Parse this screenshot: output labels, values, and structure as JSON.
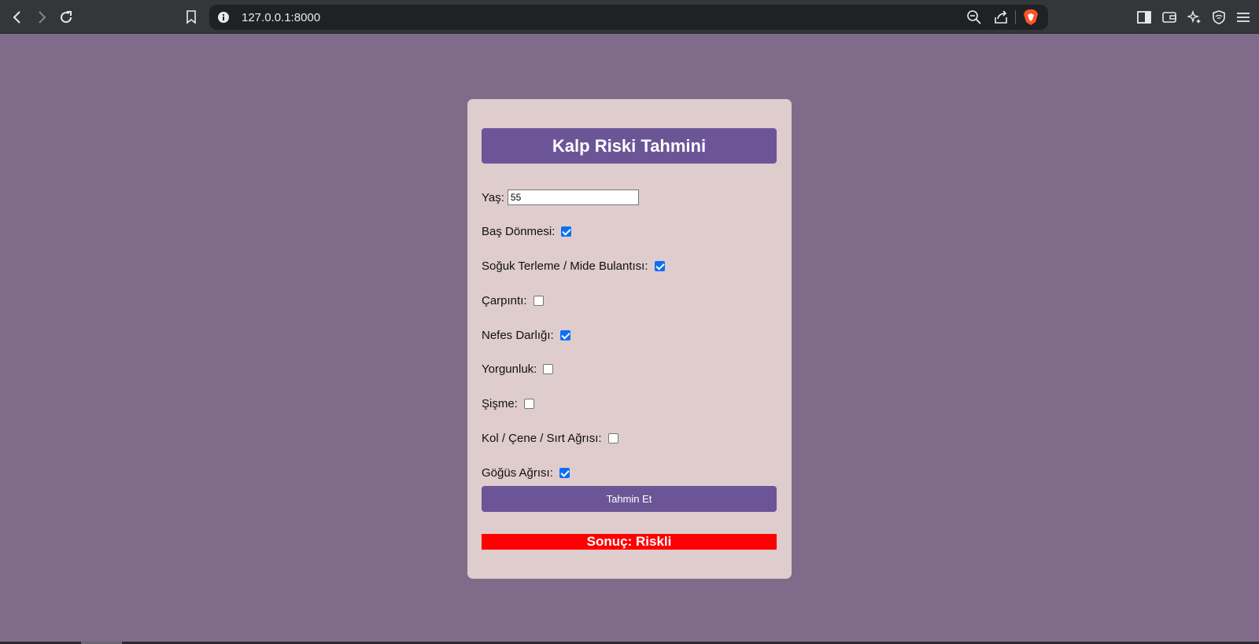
{
  "browser": {
    "url": "127.0.0.1:8000"
  },
  "form": {
    "title": "Kalp Riski Tahmini",
    "age_label": "Yaş:",
    "age_value": "55",
    "fields": [
      {
        "label": "Baş Dönmesi:",
        "checked": true
      },
      {
        "label": "Soğuk Terleme / Mide Bulantısı:",
        "checked": true
      },
      {
        "label": "Çarpıntı:",
        "checked": false
      },
      {
        "label": "Nefes Darlığı:",
        "checked": true
      },
      {
        "label": "Yorgunluk:",
        "checked": false
      },
      {
        "label": "Şişme:",
        "checked": false
      },
      {
        "label": "Kol / Çene / Sırt Ağrısı:",
        "checked": false
      },
      {
        "label": "Göğüs Ağrısı:",
        "checked": true
      }
    ],
    "submit_label": "Tahmin Et",
    "result_text": "Sonuç: Riskli"
  },
  "colors": {
    "page_background": "#806c8a",
    "card_background": "#dfcccc",
    "accent": "#6c5597",
    "result_background": "#ff0000"
  },
  "icons": [
    "back-icon",
    "forward-icon",
    "reload-icon",
    "bookmark-icon",
    "site-info-icon",
    "zoom-icon",
    "share-icon",
    "brave-shields-icon",
    "sidebar-icon",
    "wallet-icon",
    "leo-ai-icon",
    "vpn-icon",
    "menu-icon"
  ]
}
